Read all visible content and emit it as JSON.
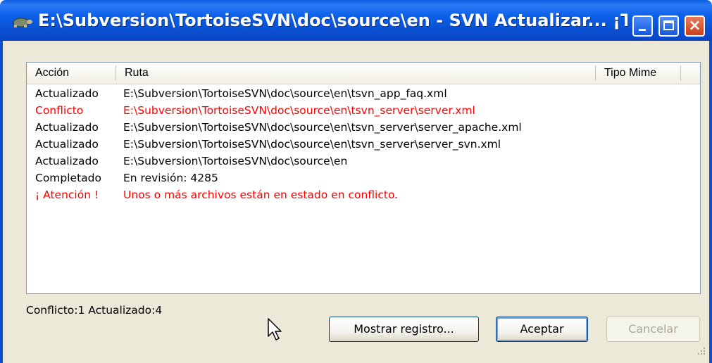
{
  "window": {
    "title": "E:\\Subversion\\TortoiseSVN\\doc\\source\\en - SVN Actualizar... ¡Termina...",
    "controls": {
      "minimize": "minimize",
      "maximize": "maximize",
      "close": "×"
    }
  },
  "list": {
    "columns": [
      "Acción",
      "Ruta",
      "Tipo Mime"
    ],
    "rows": [
      {
        "accion": "Actualizado",
        "ruta": "E:\\Subversion\\TortoiseSVN\\doc\\source\\en\\tsvn_app_faq.xml",
        "red": false
      },
      {
        "accion": "Conflicto",
        "ruta": "E:\\Subversion\\TortoiseSVN\\doc\\source\\en\\tsvn_server\\server.xml",
        "red": true
      },
      {
        "accion": "Actualizado",
        "ruta": "E:\\Subversion\\TortoiseSVN\\doc\\source\\en\\tsvn_server\\server_apache.xml",
        "red": false
      },
      {
        "accion": "Actualizado",
        "ruta": "E:\\Subversion\\TortoiseSVN\\doc\\source\\en\\tsvn_server\\server_svn.xml",
        "red": false
      },
      {
        "accion": "Actualizado",
        "ruta": "E:\\Subversion\\TortoiseSVN\\doc\\source\\en",
        "red": false
      },
      {
        "accion": "Completado",
        "ruta": "En revisión: 4285",
        "red": false
      },
      {
        "accion": "¡ Atención !",
        "ruta": "Unos o más archivos están en estado en conflicto.",
        "red": true
      }
    ]
  },
  "status_text": "Conflicto:1 Actualizado:4",
  "buttons": {
    "show_log": "Mostrar registro...",
    "ok": "Aceptar",
    "cancel": "Cancelar"
  },
  "colors": {
    "conflict": "#ff0000",
    "titlebar": "#0a5be0",
    "list_border": "#7f9db9"
  }
}
